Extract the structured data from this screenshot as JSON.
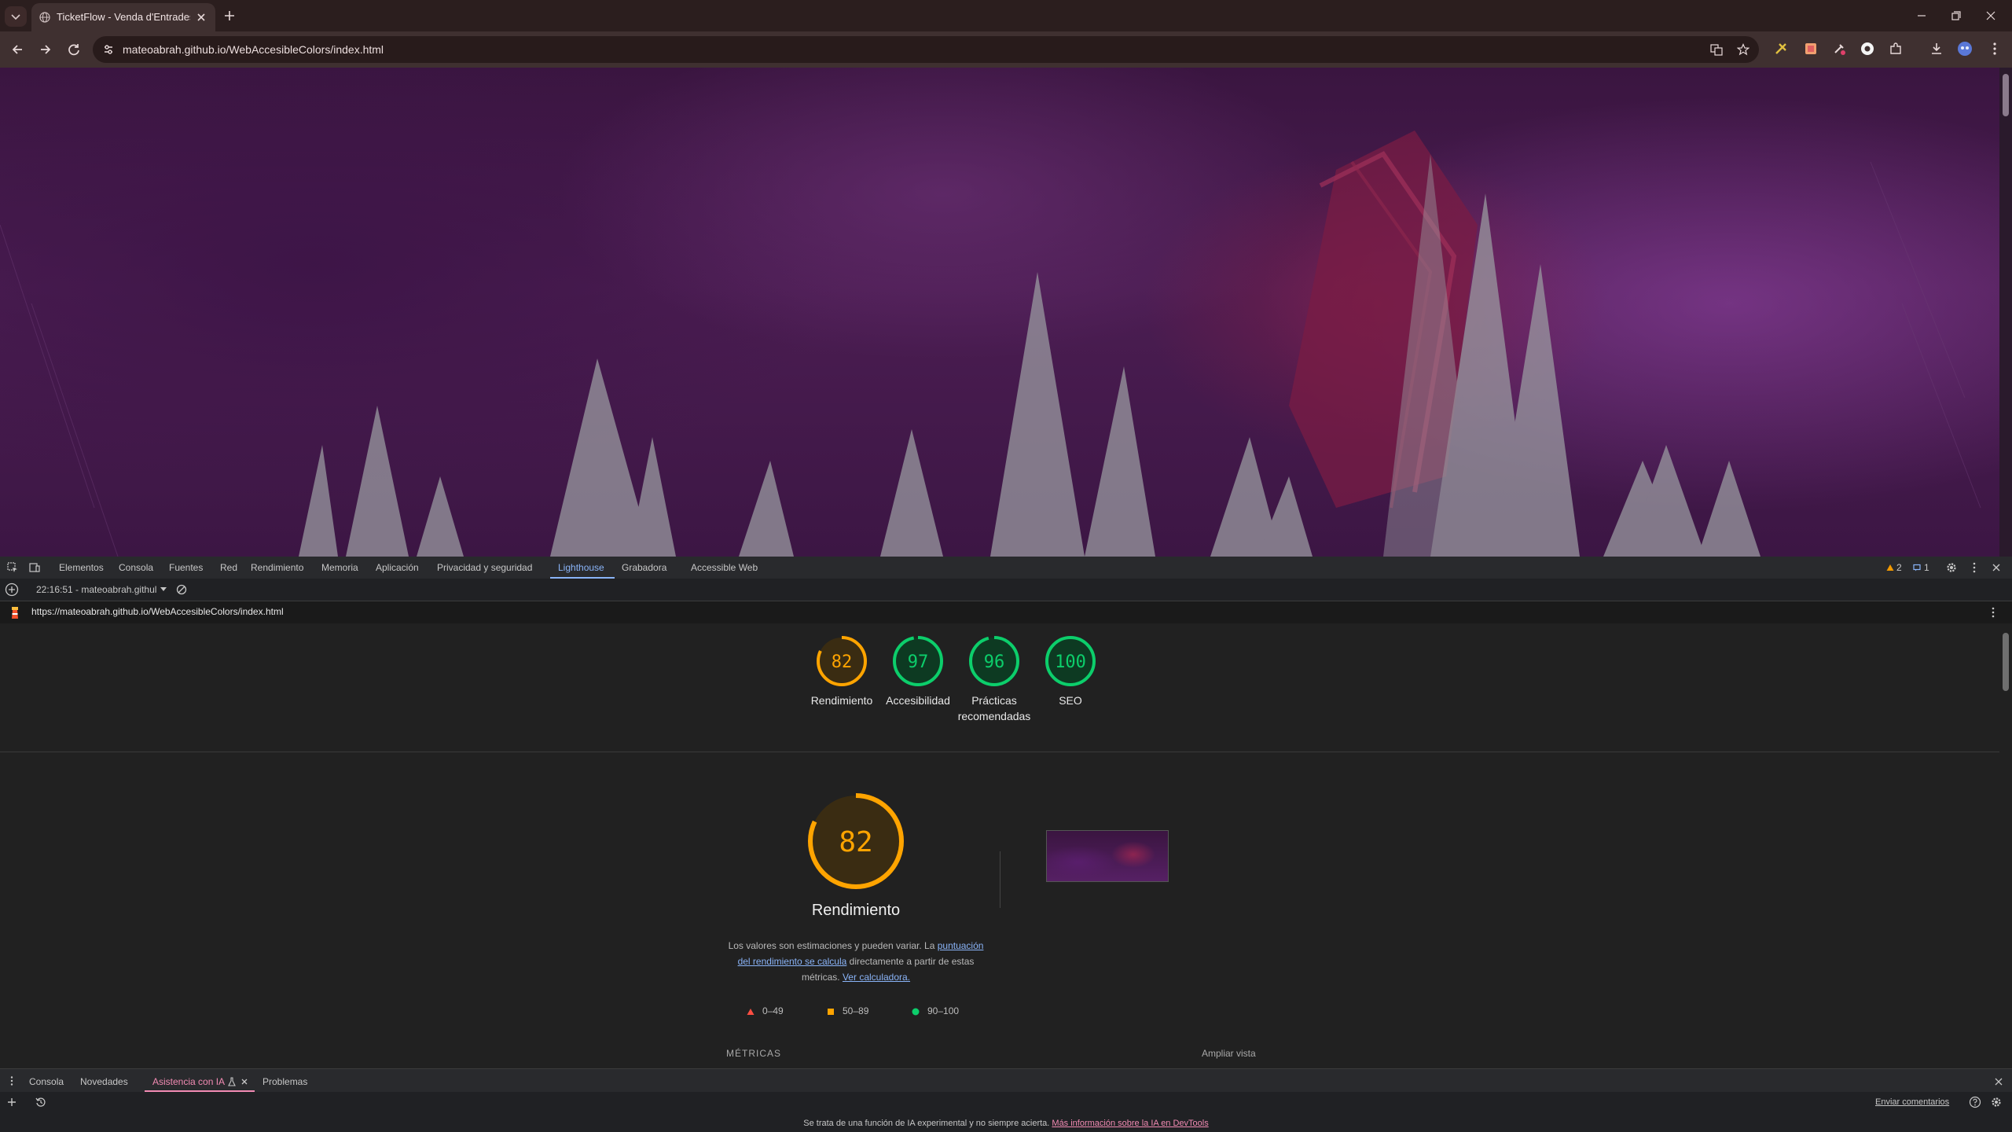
{
  "browser": {
    "tab_title": "TicketFlow - Venda d'Entrades",
    "url": "mateoabrah.github.io/WebAccesibleColors/index.html"
  },
  "devtools": {
    "tabs": [
      "Elementos",
      "Consola",
      "Fuentes",
      "Red",
      "Rendimiento",
      "Memoria",
      "Aplicación",
      "Privacidad y seguridad",
      "Lighthouse",
      "Grabadora",
      "Accessible Web"
    ],
    "active_tab": "Lighthouse",
    "warnings_count": "2",
    "messages_count": "1"
  },
  "lighthouse": {
    "report_selector": "22:16:51 - mateoabrah.githul",
    "report_url": "https://mateoabrah.github.io/WebAccesibleColors/index.html",
    "scores": [
      {
        "value": 82,
        "label": "Rendimiento",
        "status": "average"
      },
      {
        "value": 97,
        "label": "Accesibilidad",
        "status": "pass"
      },
      {
        "value": 96,
        "label": "Prácticas recomendadas",
        "status": "pass"
      },
      {
        "value": 100,
        "label": "SEO",
        "status": "pass"
      }
    ],
    "performance": {
      "score": 82,
      "title": "Rendimiento",
      "desc_part1": "Los valores son estimaciones y pueden variar. La ",
      "desc_link1": "puntuación del rendimiento se calcula",
      "desc_part2": " directamente a partir de estas métricas. ",
      "desc_link2": "Ver calculadora.",
      "legend": [
        {
          "range": "0–49",
          "shape": "triangle",
          "color": "#ff4e42"
        },
        {
          "range": "50–89",
          "shape": "square",
          "color": "#ffa400"
        },
        {
          "range": "90–100",
          "shape": "circle",
          "color": "#0cce6b"
        }
      ],
      "metrics_heading": "MÉTRICAS",
      "expand_view": "Ampliar vista"
    }
  },
  "drawer": {
    "tabs": [
      "Consola",
      "Novedades",
      "Asistencia con IA",
      "Problemas"
    ],
    "active_tab": "Asistencia con IA",
    "feedback": "Enviar comentarios",
    "disclaimer_text": "Se trata de una función de IA experimental y no siempre acierta. ",
    "disclaimer_link": "Más información sobre la IA en DevTools"
  },
  "colors": {
    "average": "#ffa400",
    "pass": "#0cce6b",
    "accent_blue": "#8ab4f8",
    "ai_pink": "#f28bb3"
  }
}
